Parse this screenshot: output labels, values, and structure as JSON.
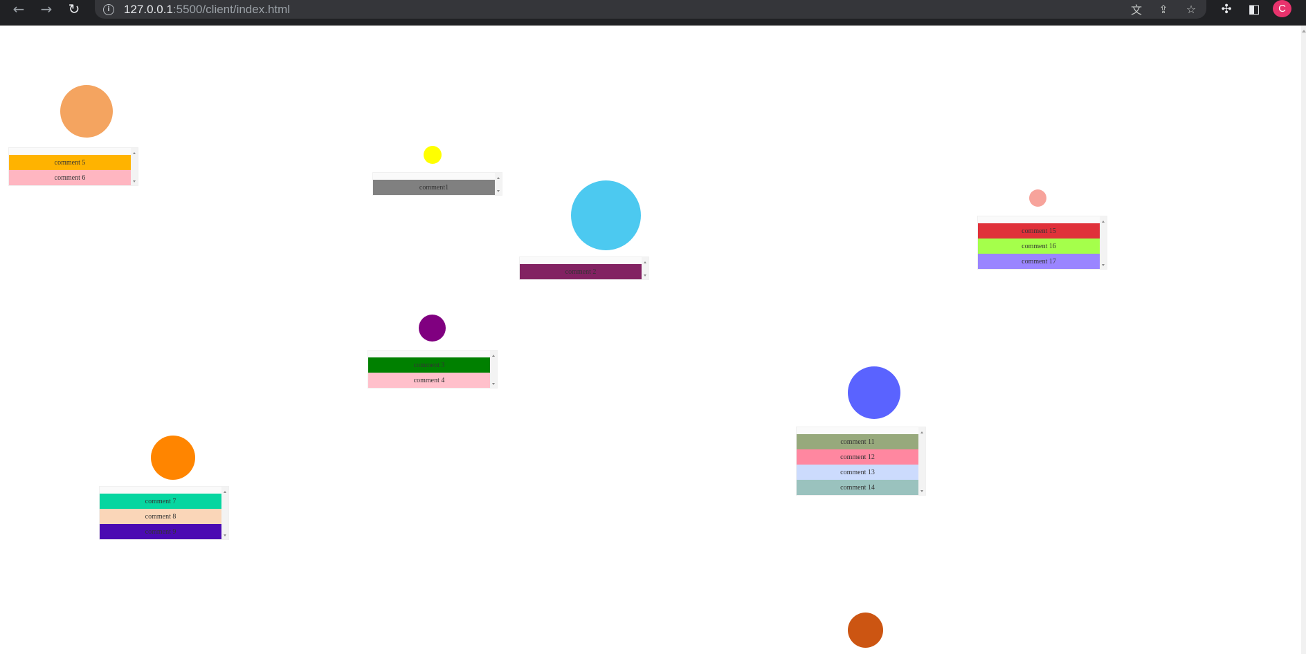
{
  "browser": {
    "url_host": "127.0.0.1",
    "url_path": ":5500/client/index.html",
    "avatar_letter": "C",
    "icons": [
      "back-arrow-icon",
      "forward-arrow-icon",
      "reload-icon",
      "site-info-icon",
      "translate-icon",
      "share-icon",
      "bookmark-star-icon",
      "extensions-puzzle-icon",
      "side-panel-icon"
    ]
  },
  "nodes": [
    {
      "id": "peach",
      "color": "#F4A460",
      "comments": [
        {
          "text": "comment 5",
          "color": "#FFB300"
        },
        {
          "text": "comment 6",
          "color": "#FFB6C1"
        }
      ]
    },
    {
      "id": "yellow",
      "color": "#FFFF00",
      "comments": [
        {
          "text": "comment1",
          "color": "#808080"
        }
      ]
    },
    {
      "id": "sky",
      "color": "#4CC9F0",
      "comments": [
        {
          "text": "comment 2",
          "color": "#822262"
        }
      ]
    },
    {
      "id": "purple",
      "color": "#800080",
      "comments": [
        {
          "text": "comment 3",
          "color": "#008000"
        },
        {
          "text": "comment 4",
          "color": "#FFC0CB"
        }
      ]
    },
    {
      "id": "orange",
      "color": "#FF8500",
      "comments": [
        {
          "text": "comment 7",
          "color": "#06D6A0"
        },
        {
          "text": "comment 8",
          "color": "#FAD6B8"
        },
        {
          "text": "comment 9",
          "color": "#4B0AB2"
        }
      ]
    },
    {
      "id": "blue",
      "color": "#5A63FF",
      "comments": [
        {
          "text": "comment 11",
          "color": "#97A97C"
        },
        {
          "text": "comment 12",
          "color": "#FF87A0"
        },
        {
          "text": "comment 13",
          "color": "#CCDBFD"
        },
        {
          "text": "comment 14",
          "color": "#9AC2BE"
        }
      ]
    },
    {
      "id": "salmon",
      "color": "#F7A39B",
      "comments": [
        {
          "text": "comment 15",
          "color": "#E0313A"
        },
        {
          "text": "comment 16",
          "color": "#A5FF4B"
        },
        {
          "text": "comment 17",
          "color": "#9A85FF"
        }
      ]
    },
    {
      "id": "rust",
      "color": "#CC5512",
      "comments": []
    }
  ]
}
